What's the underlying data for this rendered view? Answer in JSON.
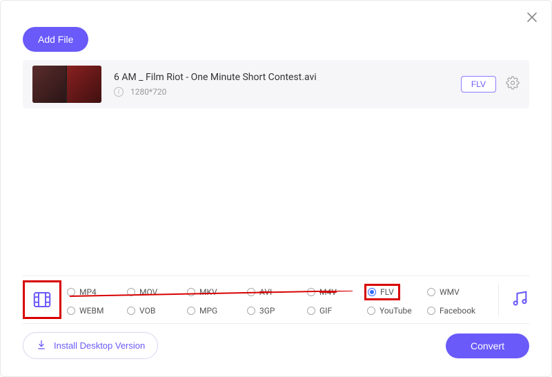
{
  "header": {
    "add_file_label": "Add File"
  },
  "file": {
    "title": "6 AM _ Film Riot - One Minute Short Contest.avi",
    "resolution": "1280*720",
    "format_badge": "FLV"
  },
  "formats": {
    "row1": [
      "MP4",
      "MOV",
      "MKV",
      "AVI",
      "M4V",
      "FLV",
      "WMV"
    ],
    "row2": [
      "WEBM",
      "VOB",
      "MPG",
      "3GP",
      "GIF",
      "YouTube",
      "Facebook"
    ],
    "selected": "FLV"
  },
  "footer": {
    "install_label": "Install Desktop Version",
    "convert_label": "Convert"
  }
}
